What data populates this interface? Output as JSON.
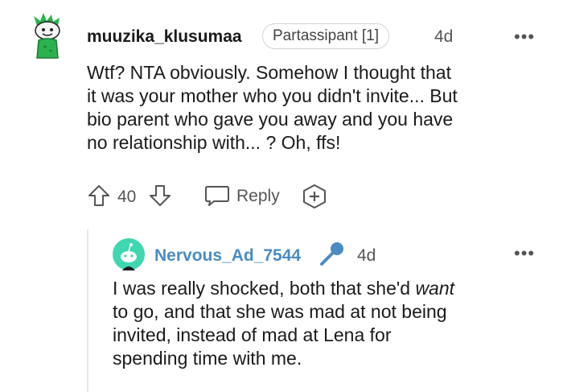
{
  "comment": {
    "username": "muuzika_klusumaa",
    "flair": "Partassipant [1]",
    "time": "4d",
    "more": "•••",
    "lines": [
      "Wtf? NTA obviously. Somehow I thought that",
      "it was your mother who you didn't invite... But",
      "bio parent who gave you away and you have",
      "no relationship with... ? Oh, ffs!"
    ],
    "score": "40",
    "reply_label": "Reply",
    "icons": [
      "upvote-icon",
      "downvote-icon",
      "chat-bubble-icon",
      "award-plus-icon",
      "avatar-snoo-green",
      "more-options-icon"
    ]
  },
  "reply": {
    "username": "Nervous_Ad_7544",
    "time": "4d",
    "more": "•••",
    "line1_pre": "I was really shocked, both that she'd ",
    "line1_em": "want",
    "lines": [
      "to go, and that she was mad at not being",
      "invited, instead of mad at Lena for",
      "spending time with me."
    ],
    "icons": [
      "avatar-snoo-teal",
      "microphone-icon",
      "more-options-icon"
    ]
  },
  "colors": {
    "accent_blue": "#4a8cc2",
    "avatar_green": "#2bb24c",
    "avatar_teal": "#3fd7b0",
    "thread_line": "#e4e6e8"
  }
}
